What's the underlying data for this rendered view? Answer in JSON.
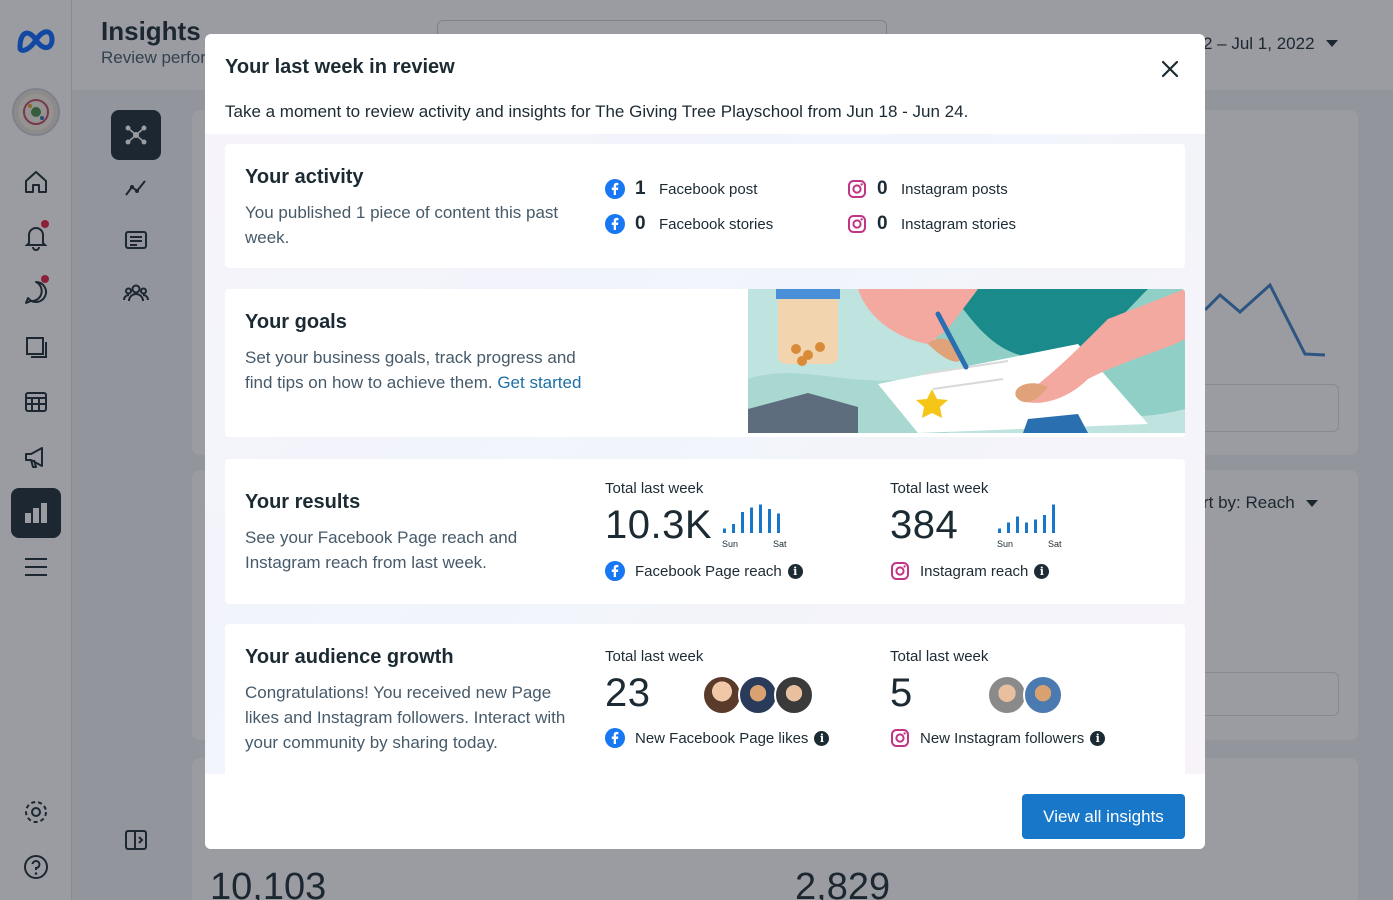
{
  "app": {
    "title": "Insights",
    "subtitle": "Review perfor",
    "date_range": "2 – Jul 1, 2022",
    "sort_label": "rt by: Reach",
    "bottom_values": [
      "10,103",
      "2,829"
    ]
  },
  "modal": {
    "title": "Your last week in review",
    "intro": "Take a moment to review activity and insights for The Giving Tree Playschool from Jun 18 - Jun 24.",
    "activity": {
      "title": "Your activity",
      "text": "You published 1 piece of content this past week.",
      "stats": [
        {
          "icon": "facebook-icon",
          "value": "1",
          "label": "Facebook post"
        },
        {
          "icon": "instagram-icon",
          "value": "0",
          "label": "Instagram posts"
        },
        {
          "icon": "facebook-icon",
          "value": "0",
          "label": "Facebook stories"
        },
        {
          "icon": "instagram-icon",
          "value": "0",
          "label": "Instagram stories"
        }
      ]
    },
    "goals": {
      "title": "Your goals",
      "text": "Set your business goals, track progress and find tips on how to achieve them.",
      "link": "Get started"
    },
    "results": {
      "title": "Your results",
      "text": "See your Facebook Page reach and Instagram reach from last week.",
      "facebook": {
        "caption": "Total last week",
        "value": "10.3K",
        "label": "Facebook Page reach",
        "day_start": "Sun",
        "day_end": "Sat",
        "daily_relative": [
          0.15,
          0.3,
          0.7,
          0.85,
          0.95,
          0.8,
          0.65
        ]
      },
      "instagram": {
        "caption": "Total last week",
        "value": "384",
        "label": "Instagram reach",
        "day_start": "Sun",
        "day_end": "Sat",
        "daily_relative": [
          0.15,
          0.35,
          0.55,
          0.35,
          0.45,
          0.6,
          0.95
        ]
      }
    },
    "audience": {
      "title": "Your audience growth",
      "text": "Congratulations! You received new Page likes and Instagram followers. Interact with your community by sharing today.",
      "facebook": {
        "caption": "Total last week",
        "value": "23",
        "label": "New Facebook Page likes"
      },
      "instagram": {
        "caption": "Total last week",
        "value": "5",
        "label": "New Instagram followers"
      }
    },
    "cta": "View all insights"
  },
  "colors": {
    "facebook": "#1877f2",
    "instagram": "#c13584",
    "primary_button": "#1877c9",
    "link": "#1d6fa5",
    "spark_bars": "#1877c9"
  }
}
